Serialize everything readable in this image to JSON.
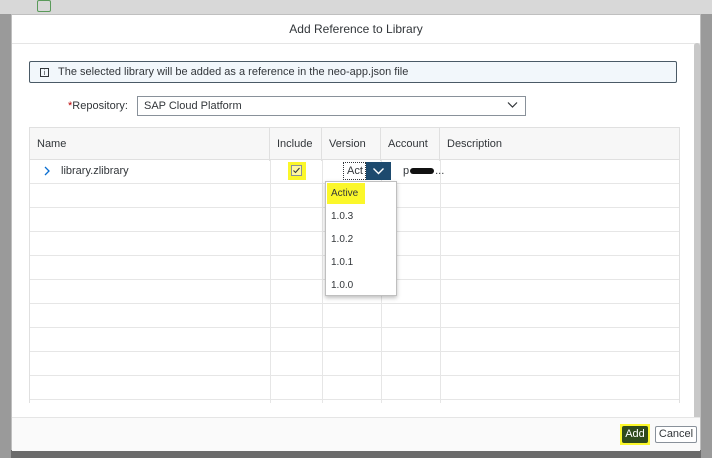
{
  "dialog": {
    "title": "Add Reference to Library",
    "info": "The selected library will be added as a reference in the neo-app.json file",
    "repository": {
      "label": "Repository:",
      "value": "SAP Cloud Platform"
    },
    "table": {
      "columns": [
        "Name",
        "Include",
        "Version",
        "Account",
        "Description"
      ],
      "rows": [
        {
          "name": "library.zlibrary",
          "include_checked": true,
          "version": "Act",
          "account_prefix": "p",
          "account_suffix": "..."
        }
      ]
    },
    "version_dropdown": {
      "options": [
        "Active",
        "1.0.3",
        "1.0.2",
        "1.0.1",
        "1.0.0"
      ],
      "selected": "Active"
    },
    "footer": {
      "add_label": "Add",
      "cancel_label": "Cancel"
    }
  },
  "colors": {
    "highlight": "#fbf72a",
    "accept": "#2f4a1c",
    "select_button": "#1d4a6e",
    "required": "#bb0000"
  },
  "icons": [
    "info-icon",
    "chevron-down-icon",
    "chevron-right-icon",
    "checkmark-icon"
  ]
}
